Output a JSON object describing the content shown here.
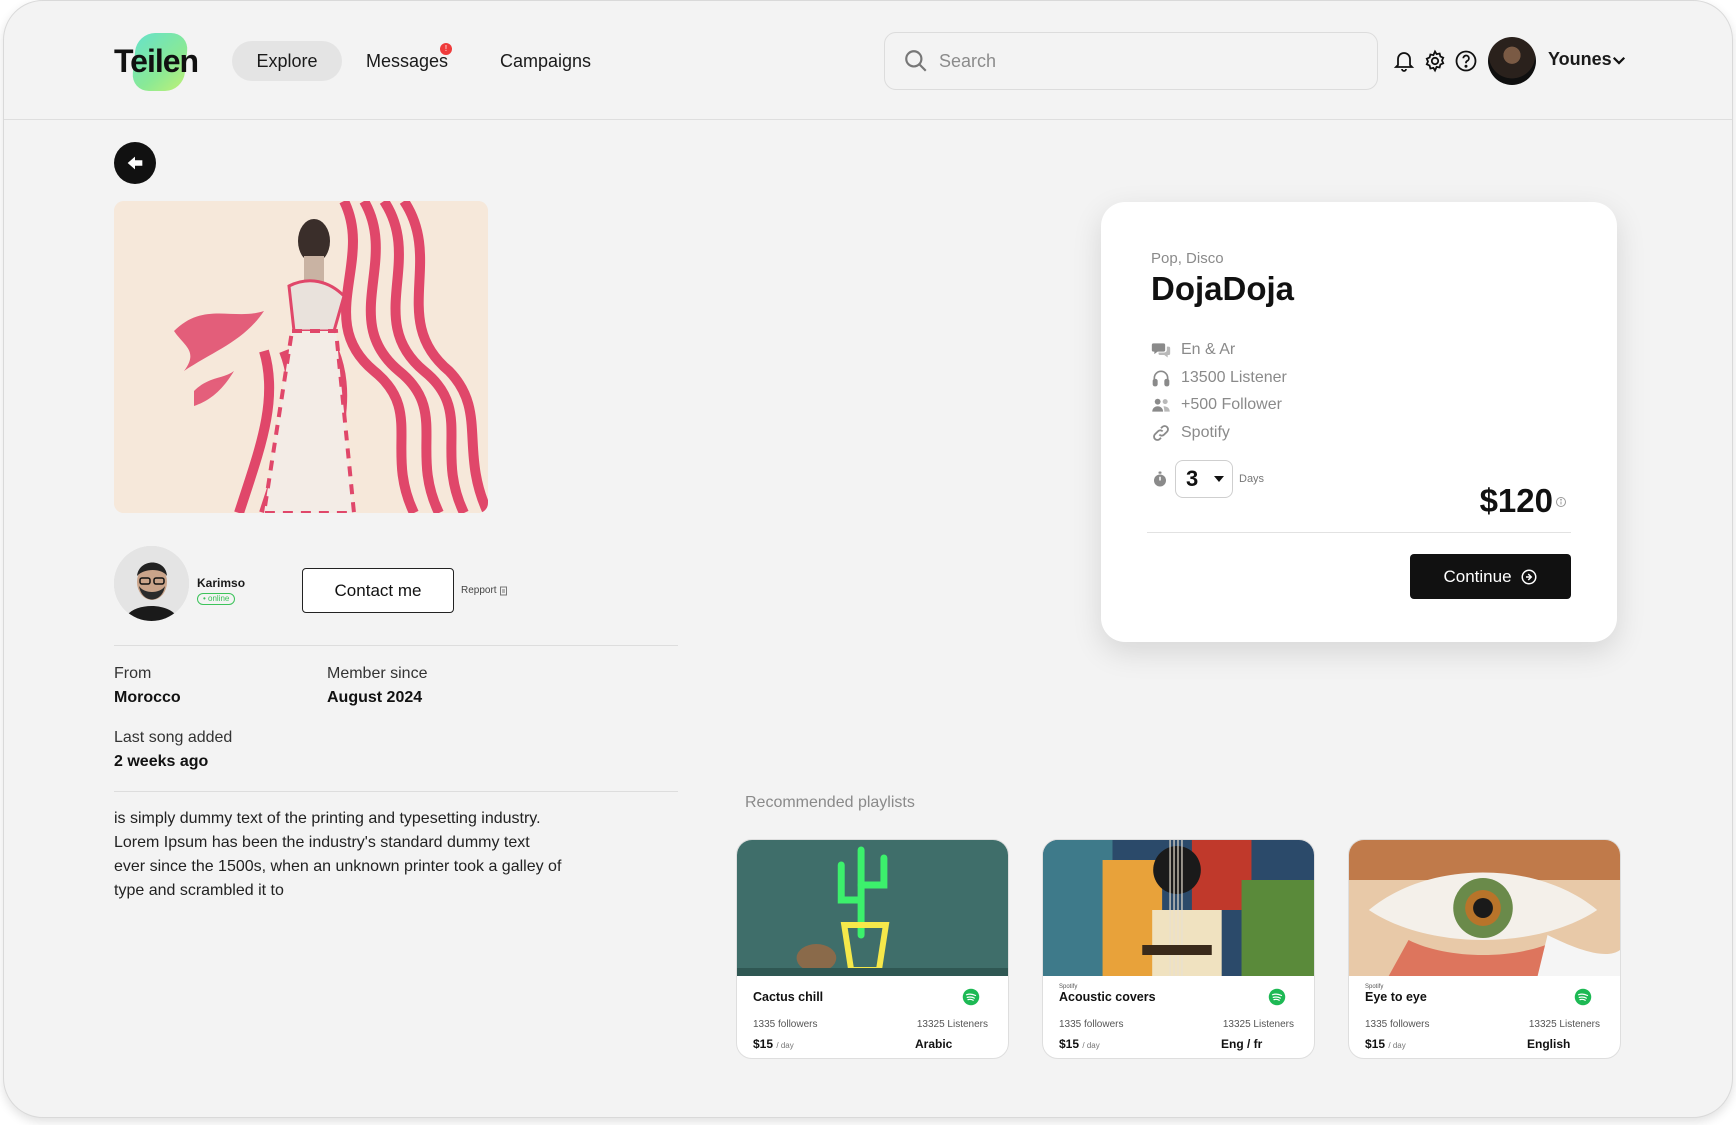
{
  "header": {
    "logo_text": "Teilen",
    "nav": {
      "explore": "Explore",
      "messages": "Messages",
      "messages_badge": "!",
      "campaigns": "Campaigns"
    },
    "search_placeholder": "Search",
    "user_name": "Younes"
  },
  "seller": {
    "name": "Karimso",
    "status": "• online",
    "contact_label": "Contact me",
    "report_label": "Repport"
  },
  "details": {
    "from_label": "From",
    "from_value": "Morocco",
    "member_label": "Member since",
    "member_value": "August 2024",
    "last_song_label": "Last song added",
    "last_song_value": "2 weeks ago"
  },
  "bio": "is simply dummy text of the printing and typesetting industry. Lorem Ipsum has been the industry's standard dummy text ever since the 1500s, when an unknown printer took a galley of type and scrambled it to",
  "offer": {
    "genre": "Pop, Disco",
    "title": "DojaDoja",
    "languages": "En & Ar",
    "listeners": "13500 Listener",
    "followers": "+500 Follower",
    "platform": "Spotify",
    "days_value": "3",
    "days_label": "Days",
    "price": "$120",
    "continue_label": "Continue"
  },
  "recommended": {
    "title": "Recommended playlists",
    "items": [
      {
        "source": "",
        "name": "Cactus chill",
        "followers": "1335 followers",
        "listeners": "13325 Listeners",
        "price": "$15",
        "per": "/ day",
        "language": "Arabic"
      },
      {
        "source": "Spotify",
        "name": "Acoustic covers",
        "followers": "1335 followers",
        "listeners": "13325 Listeners",
        "price": "$15",
        "per": "/ day",
        "language": "Eng / fr"
      },
      {
        "source": "Spotify",
        "name": "Eye to eye",
        "followers": "1335 followers",
        "listeners": "13325 Listeners",
        "price": "$15",
        "per": "/ day",
        "language": "English"
      }
    ]
  },
  "colors": {
    "accent_dark": "#111111",
    "online_green": "#3cc35a",
    "badge_red": "#ef3b3b",
    "spotify_green": "#1db954",
    "art_pink": "#e0476a"
  }
}
